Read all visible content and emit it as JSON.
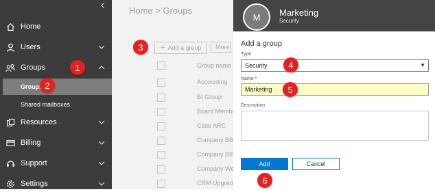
{
  "nav": {
    "collapse_icon": "chevron-left-icon",
    "items": [
      {
        "label": "Home",
        "icon": "home-icon"
      },
      {
        "label": "Users",
        "icon": "user-icon"
      },
      {
        "label": "Groups",
        "icon": "groups-icon"
      },
      {
        "label": "Resources",
        "icon": "resources-icon"
      },
      {
        "label": "Billing",
        "icon": "billing-icon"
      },
      {
        "label": "Support",
        "icon": "headset-icon"
      },
      {
        "label": "Settings",
        "icon": "gear-icon"
      }
    ],
    "sub_items": [
      {
        "label": "Groups",
        "active": true
      },
      {
        "label": "Shared mailboxes",
        "active": false
      }
    ]
  },
  "main": {
    "breadcrumb": "Home > Groups",
    "add_group_label": "Add a group",
    "more_label": "More",
    "column_header": "Group name",
    "groups": [
      "Accounting",
      "BI Group",
      "Board Members",
      "Case ARC",
      "Company BBC",
      "Company BIS",
      "Company We",
      "CRM Upgrade"
    ]
  },
  "panel": {
    "avatar_letter": "M",
    "title": "Marketing",
    "subtitle": "Security",
    "form_title": "Add a group",
    "type_label": "Type",
    "type_value": "Security",
    "name_label": "Name *",
    "name_value": "Marketing",
    "description_label": "Description",
    "add_label": "Add",
    "cancel_label": "Cancel"
  },
  "callouts": [
    "1",
    "2",
    "3",
    "4",
    "5",
    "6"
  ],
  "colors": {
    "nav_bg": "#3c3c3c",
    "active_sub_bg": "#7d7d7d",
    "header_bg": "#444444",
    "primary": "#0078d4",
    "callout": "#e62021",
    "name_field_bg": "#fdfdc4"
  }
}
